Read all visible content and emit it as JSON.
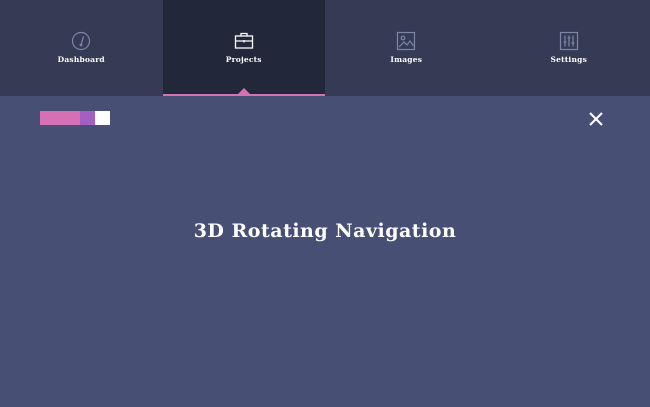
{
  "nav": {
    "items": [
      {
        "label": "Dashboard",
        "icon": "speedometer-icon",
        "active": false
      },
      {
        "label": "Projects",
        "icon": "briefcase-icon",
        "active": true
      },
      {
        "label": "Images",
        "icon": "image-icon",
        "active": false
      },
      {
        "label": "Settings",
        "icon": "sliders-icon",
        "active": false
      }
    ]
  },
  "swatches": [
    "#d470b3",
    "#a35fc1",
    "#ffffff"
  ],
  "colors": {
    "nav_bg": "#353b55",
    "nav_active_bg": "#23273a",
    "accent": "#d470b3",
    "page_bg": "#475074"
  },
  "close_icon": "close-icon",
  "main": {
    "title": "3D Rotating Navigation"
  }
}
